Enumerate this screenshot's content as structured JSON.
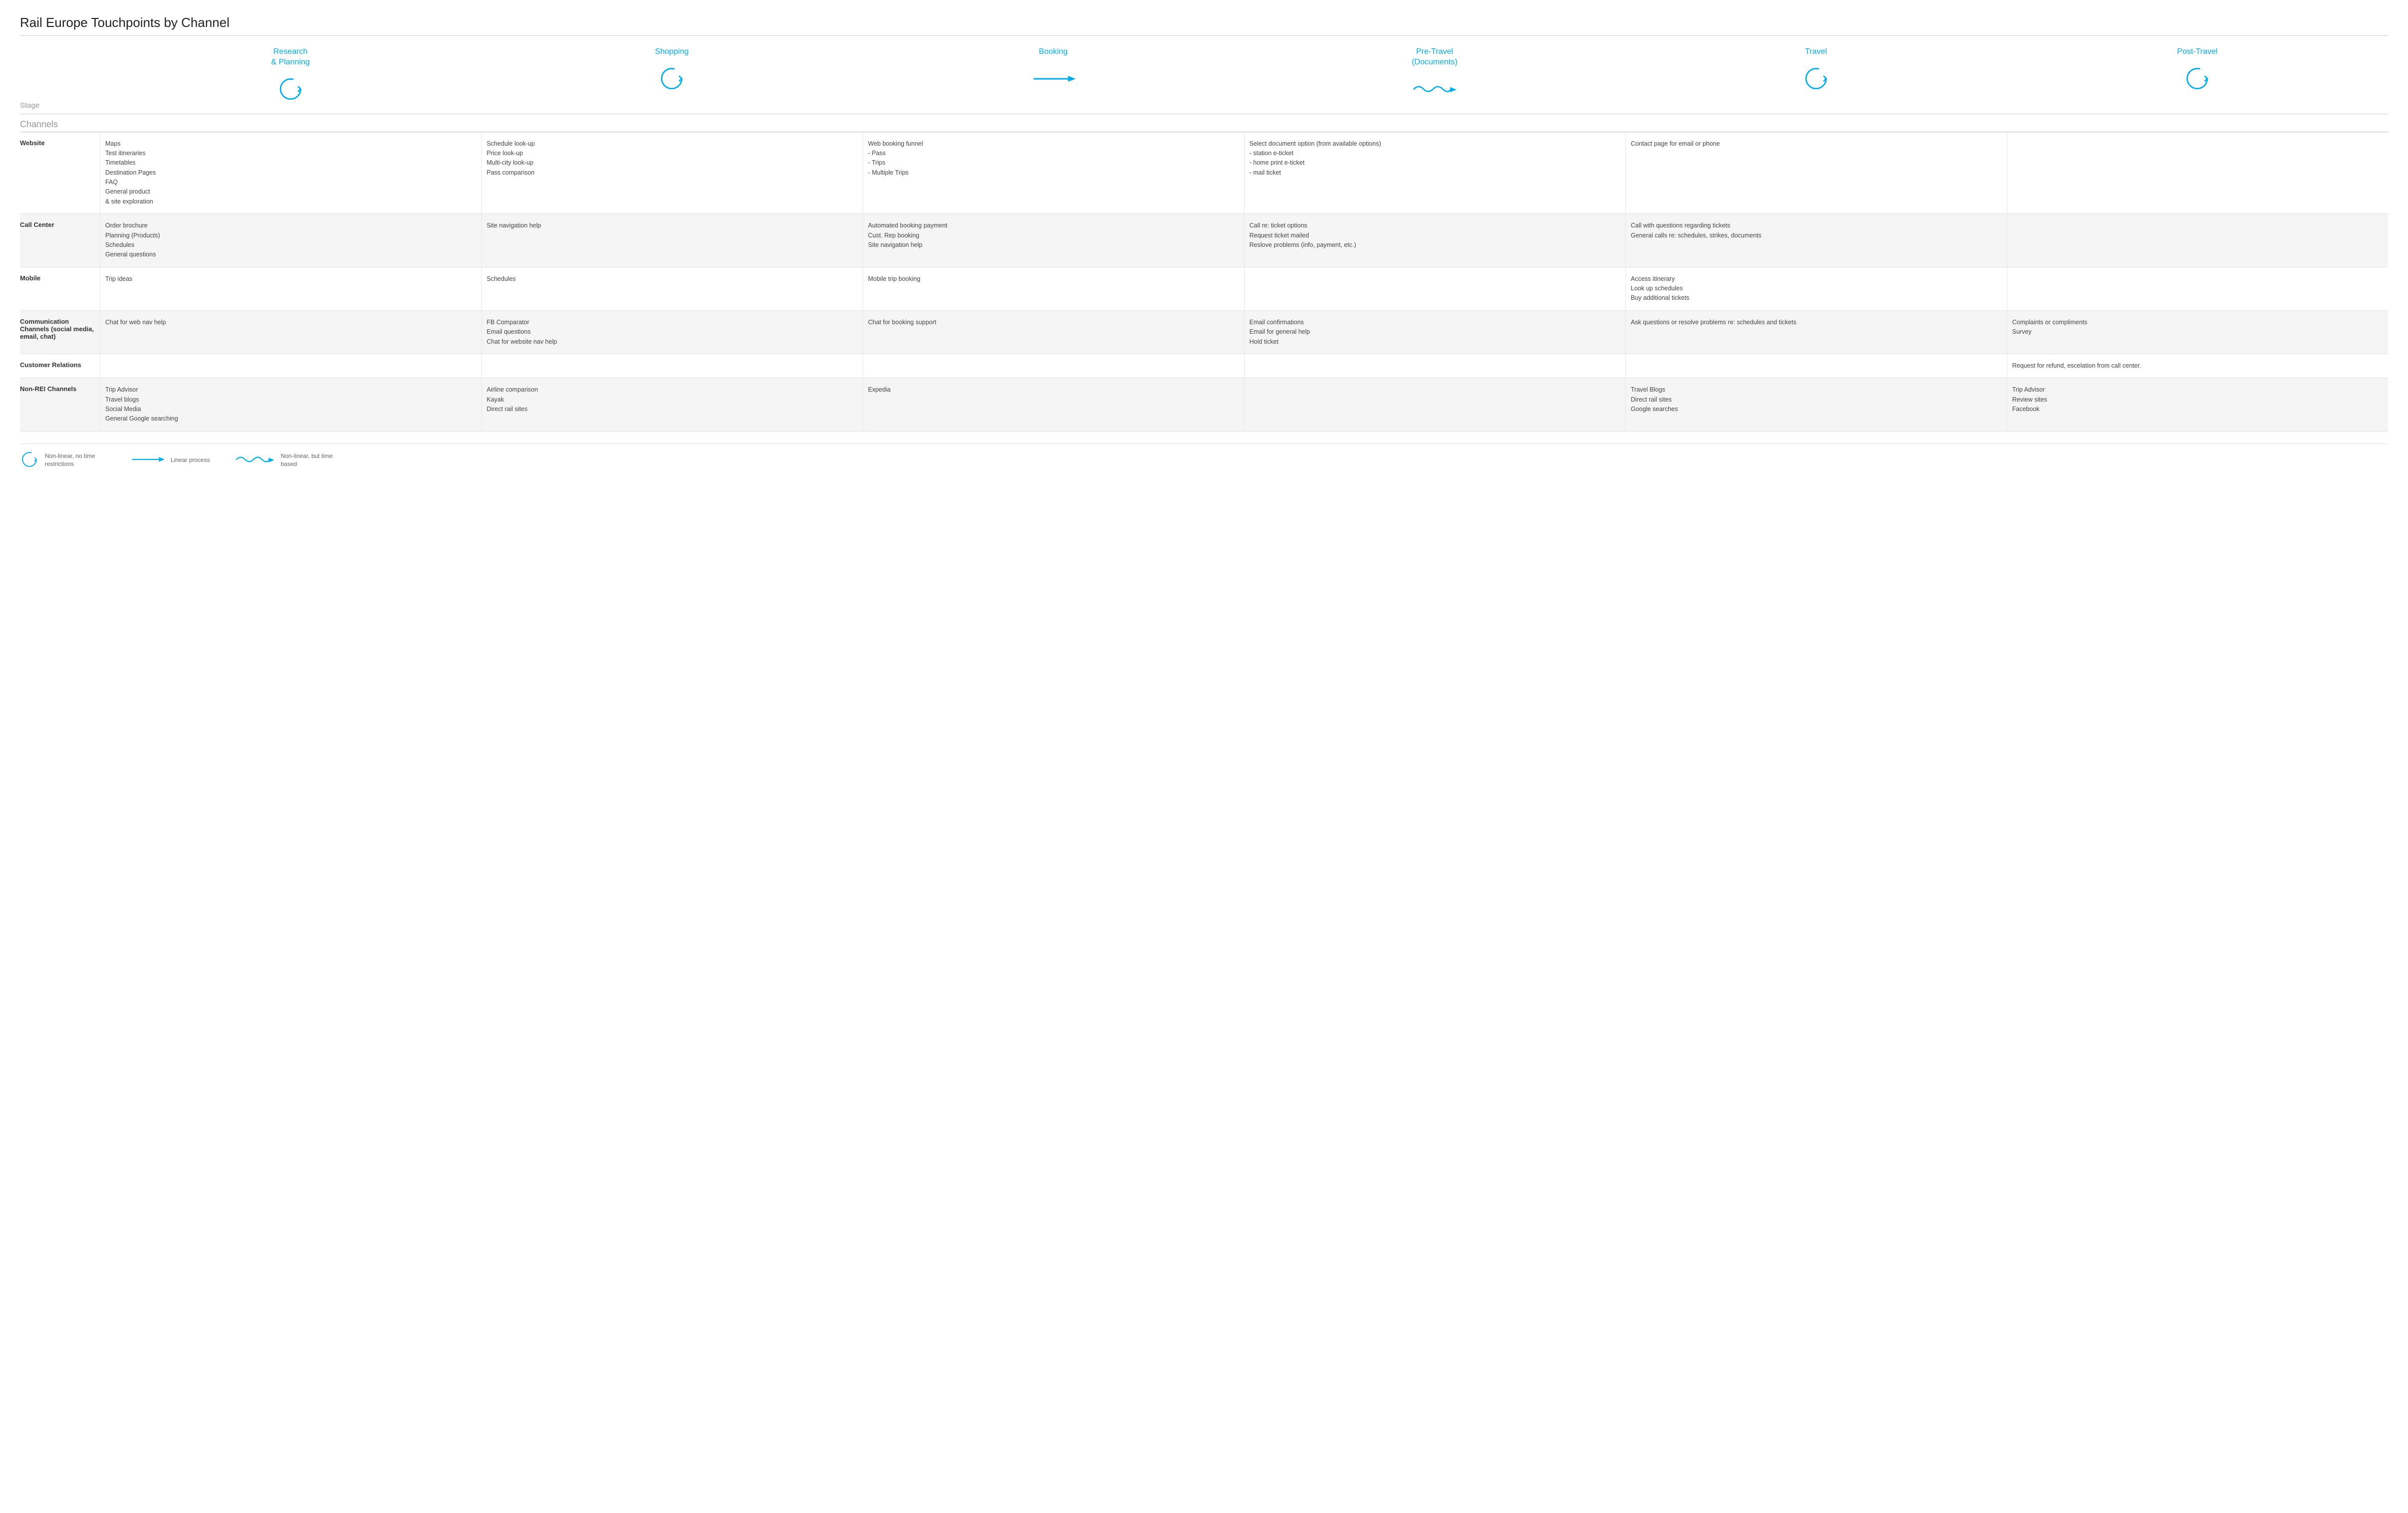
{
  "title": "Rail Europe Touchpoints by Channel",
  "stage_label": "Stage",
  "channels_label": "Channels",
  "stages": [
    {
      "id": "research",
      "name": "Research\n& Planning",
      "icon": "circle"
    },
    {
      "id": "shopping",
      "name": "Shopping",
      "icon": "circle"
    },
    {
      "id": "booking",
      "name": "Booking",
      "icon": "arrow"
    },
    {
      "id": "pretravel",
      "name": "Pre-Travel\n(Documents)",
      "icon": "wave"
    },
    {
      "id": "travel",
      "name": "Travel",
      "icon": "circle"
    },
    {
      "id": "posttravel",
      "name": "Post-Travel",
      "icon": "circle"
    }
  ],
  "rows": [
    {
      "label": "Website",
      "shaded": false,
      "cells": [
        "Maps\nTest itineraries\nTimetables\nDestination Pages\nFAQ\nGeneral product\n& site exploration",
        "Schedule look-up\nPrice look-up\nMulti-city look-up\nPass comparison",
        "Web booking funnel\n- Pass\n- Trips\n- Multiple Trips",
        "Select document option (from available options)\n- station e-ticket\n- home print e-ticket\n- mail ticket",
        "Contact page for email or phone",
        ""
      ]
    },
    {
      "label": "Call Center",
      "shaded": true,
      "cells": [
        "Order brochure\nPlanning (Products)\nSchedules\nGeneral questions",
        "Site navigation help",
        "Automated booking payment\nCust. Rep booking\nSite navigation help",
        "Call re: ticket options\nRequest ticket mailed\nReslove problems (info, payment, etc.)",
        "Call with questions regarding tickets\nGeneral calls re: schedules, strikes, documents",
        ""
      ]
    },
    {
      "label": "Mobile",
      "shaded": false,
      "cells": [
        "Trip ideas",
        "Schedules",
        "Mobile trip booking",
        "",
        "Access itinerary\nLook up schedules\nBuy additional tickets",
        ""
      ]
    },
    {
      "label": "Communication Channels (social media, email, chat)",
      "shaded": true,
      "cells": [
        "Chat for web nav help",
        "FB Comparator\nEmail questions\nChat for website nav help",
        "Chat for booking support",
        "Email confirmations\nEmail for general help\nHold ticket",
        "Ask questions or resolve problems re: schedules and tickets",
        "Complaints or compliments\nSurvey"
      ]
    },
    {
      "label": "Customer Relations",
      "shaded": false,
      "cells": [
        "",
        "",
        "",
        "",
        "",
        "Request for refund, escelation from call center."
      ]
    },
    {
      "label": "Non-REI Channels",
      "shaded": true,
      "cells": [
        "Trip Advisor\nTravel blogs\nSocial Media\nGeneral Google searching",
        "Airline comparison\nKayak\nDirect rail sites",
        "Expedia",
        "",
        "Travel Blogs\nDirect rail sites\nGoogle searches",
        "Trip Advisor\nReview sites\nFacebook"
      ]
    }
  ],
  "legend": [
    {
      "icon": "circle",
      "text": "Non-linear, no time restrictions"
    },
    {
      "icon": "arrow",
      "text": "Linear process"
    },
    {
      "icon": "wave",
      "text": "Non-linear, but time based"
    }
  ]
}
